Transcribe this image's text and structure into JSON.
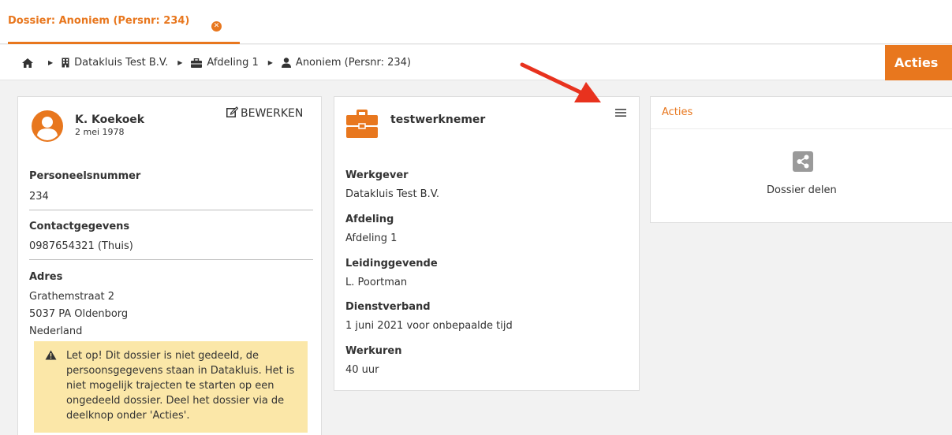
{
  "tab": {
    "label": "Dossier: Anoniem (Persnr: 234)"
  },
  "breadcrumb": {
    "items": [
      "Datakluis Test B.V.",
      "Afdeling 1",
      "Anoniem (Persnr: 234)"
    ]
  },
  "acties_button": {
    "label": "Acties"
  },
  "person_card": {
    "name": "K. Koekoek",
    "dob": "2 mei 1978",
    "edit_label": "BEWERKEN",
    "personnel_label": "Personeelsnummer",
    "personnel_value": "234",
    "contact_label": "Contactgegevens",
    "contact_value": "0987654321 (Thuis)",
    "address_label": "Adres",
    "address_line1": "Grathemstraat 2",
    "address_line2": "5037 PA Oldenborg",
    "address_line3": "Nederland",
    "warning": "Let op! Dit dossier is niet gedeeld, de persoonsgegevens staan in Datakluis. Het is niet mogelijk trajecten te starten op een ongedeeld dossier. Deel het dossier via de deelknop onder 'Acties'."
  },
  "job_card": {
    "title": "testwerknemer",
    "employer_label": "Werkgever",
    "employer_value": "Datakluis Test B.V.",
    "department_label": "Afdeling",
    "department_value": "Afdeling 1",
    "manager_label": "Leidinggevende",
    "manager_value": "L. Poortman",
    "employment_label": "Dienstverband",
    "employment_value": "1 juni 2021 voor onbepaalde tijd",
    "hours_label": "Werkuren",
    "hours_value": "40 uur"
  },
  "actions_card": {
    "title": "Acties",
    "share_label": "Dossier delen"
  },
  "colors": {
    "accent": "#e8771e",
    "warning_bg": "#fbe7a8",
    "arrow": "#e8321e"
  }
}
